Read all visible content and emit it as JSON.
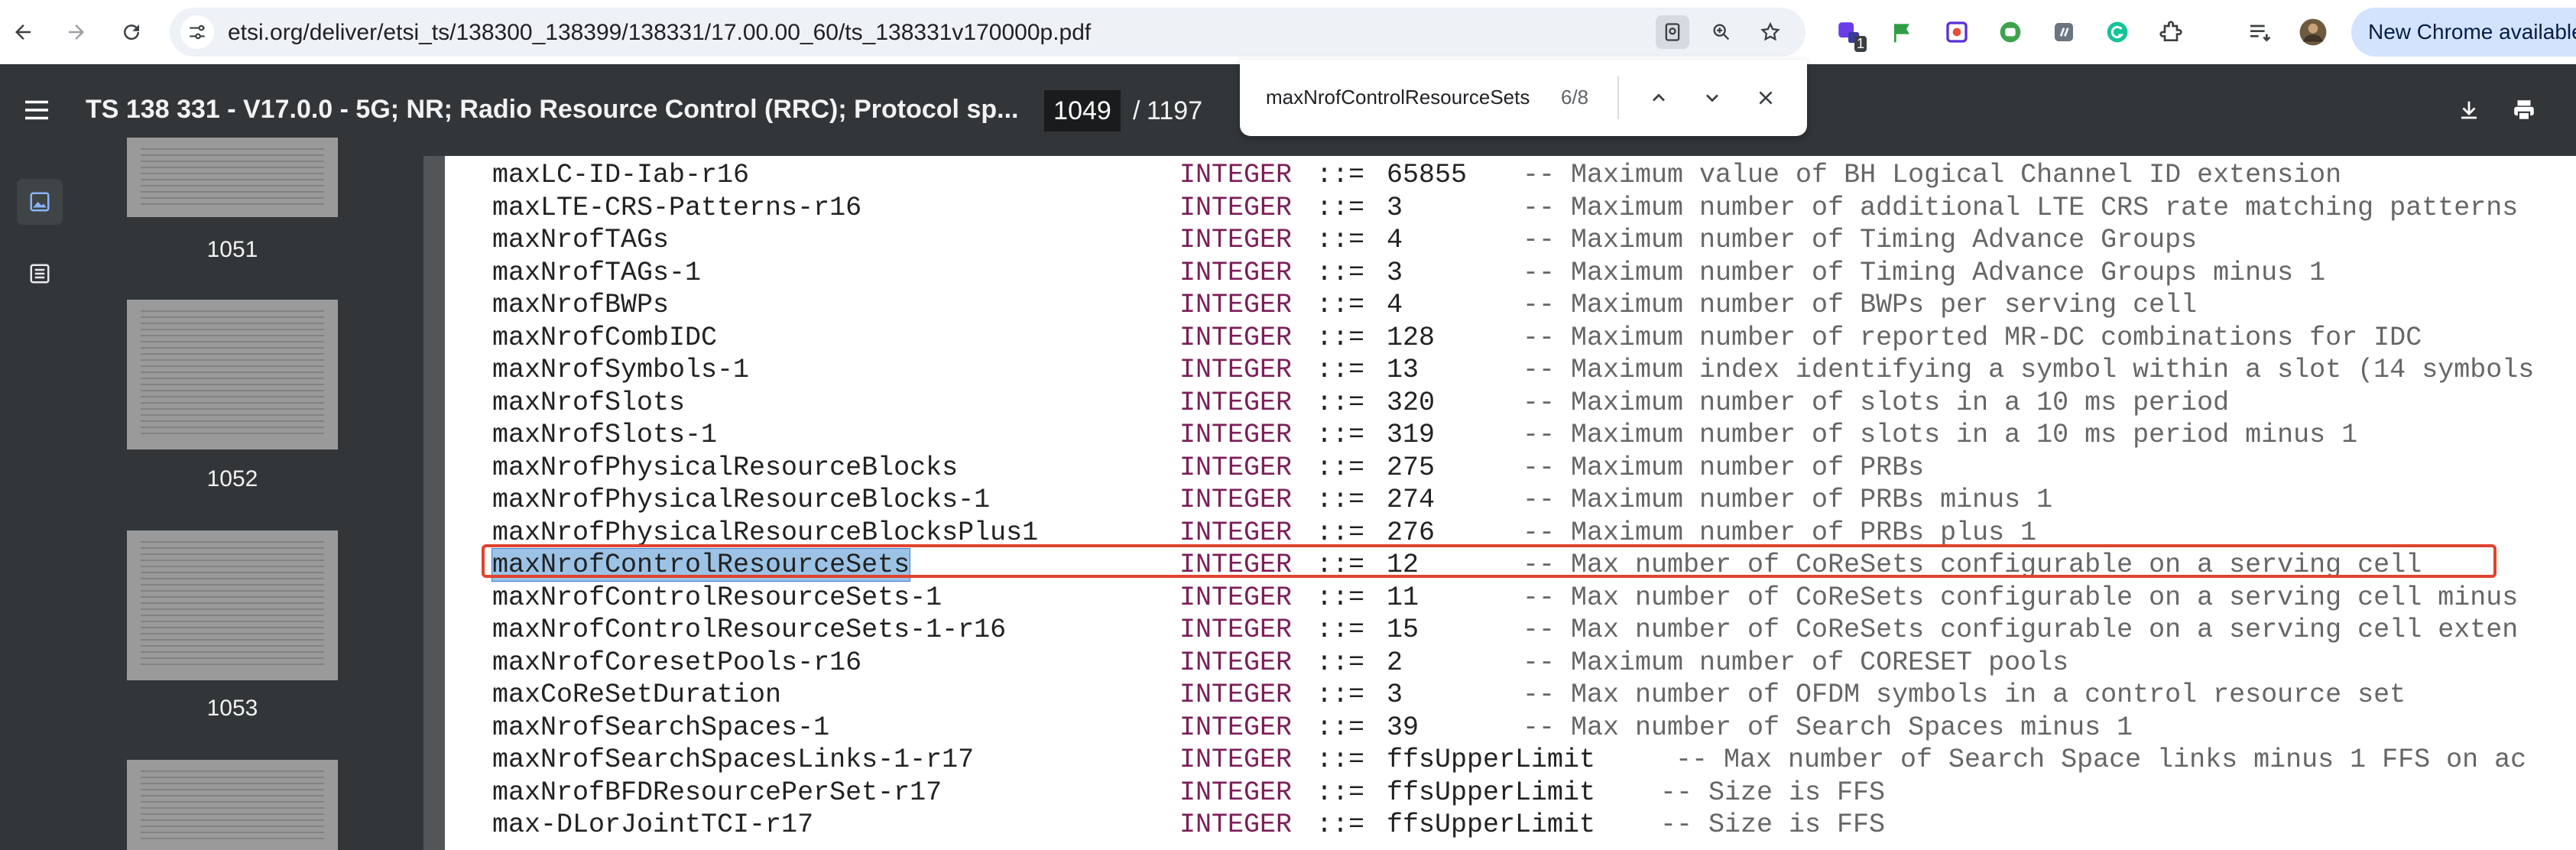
{
  "browser": {
    "url": "etsi.org/deliver/etsi_ts/138300_138399/138331/17.00.00_60/ts_138331v170000p.pdf",
    "update_label": "New Chrome available",
    "extension_badge": "1"
  },
  "toolbar": {
    "title": "TS 138 331 - V17.0.0 - 5G; NR; Radio Resource Control (RRC); Protocol sp...",
    "page_current": "1049",
    "page_separator": "/",
    "page_total": "1197"
  },
  "findbar": {
    "query": "maxNrofControlResourceSets",
    "count": "6/8"
  },
  "sidebar": {
    "thumbnails": [
      {
        "label": "1051"
      },
      {
        "label": "1052"
      },
      {
        "label": "1053"
      }
    ]
  },
  "rows": [
    {
      "name": "maxLC-ID-Iab-r16",
      "type": "INTEGER",
      "assign": "::=",
      "value": "65855",
      "comment": "-- Maximum value of BH Logical Channel ID extension"
    },
    {
      "name": "maxLTE-CRS-Patterns-r16",
      "type": "INTEGER",
      "assign": "::=",
      "value": "3",
      "comment": "-- Maximum number of additional LTE CRS rate matching patterns"
    },
    {
      "name": "maxNrofTAGs",
      "type": "INTEGER",
      "assign": "::=",
      "value": "4",
      "comment": "-- Maximum number of Timing Advance Groups"
    },
    {
      "name": "maxNrofTAGs-1",
      "type": "INTEGER",
      "assign": "::=",
      "value": "3",
      "comment": "-- Maximum number of Timing Advance Groups minus 1"
    },
    {
      "name": "maxNrofBWPs",
      "type": "INTEGER",
      "assign": "::=",
      "value": "4",
      "comment": "-- Maximum number of BWPs per serving cell"
    },
    {
      "name": "maxNrofCombIDC",
      "type": "INTEGER",
      "assign": "::=",
      "value": "128",
      "comment": "-- Maximum number of reported MR-DC combinations for IDC"
    },
    {
      "name": "maxNrofSymbols-1",
      "type": "INTEGER",
      "assign": "::=",
      "value": "13",
      "comment": "-- Maximum index identifying a symbol within a slot (14 symbols"
    },
    {
      "name": "maxNrofSlots",
      "type": "INTEGER",
      "assign": "::=",
      "value": "320",
      "comment": "-- Maximum number of slots in a 10 ms period"
    },
    {
      "name": "maxNrofSlots-1",
      "type": "INTEGER",
      "assign": "::=",
      "value": "319",
      "comment": "-- Maximum number of slots in a 10 ms period minus 1"
    },
    {
      "name": "maxNrofPhysicalResourceBlocks",
      "type": "INTEGER",
      "assign": "::=",
      "value": "275",
      "comment": "-- Maximum number of PRBs"
    },
    {
      "name": "maxNrofPhysicalResourceBlocks-1",
      "type": "INTEGER",
      "assign": "::=",
      "value": "274",
      "comment": "-- Maximum number of PRBs minus 1"
    },
    {
      "name": "maxNrofPhysicalResourceBlocksPlus1",
      "type": "INTEGER",
      "assign": "::=",
      "value": "276",
      "comment": "-- Maximum number of PRBs plus 1"
    },
    {
      "name": "maxNrofControlResourceSets",
      "type": "INTEGER",
      "assign": "::=",
      "value": "12",
      "comment": "-- Max number of CoReSets configurable on a serving cell"
    },
    {
      "name": "maxNrofControlResourceSets-1",
      "type": "INTEGER",
      "assign": "::=",
      "value": "11",
      "comment": "-- Max number of CoReSets configurable on a serving cell minus"
    },
    {
      "name": "maxNrofControlResourceSets-1-r16",
      "type": "INTEGER",
      "assign": "::=",
      "value": "15",
      "comment": "-- Max number of CoReSets configurable on a serving cell exten"
    },
    {
      "name": "maxNrofCoresetPools-r16",
      "type": "INTEGER",
      "assign": "::=",
      "value": "2",
      "comment": "-- Maximum number of CORESET pools"
    },
    {
      "name": "maxCoReSetDuration",
      "type": "INTEGER",
      "assign": "::=",
      "value": "3",
      "comment": "-- Max number of OFDM symbols in a control resource set"
    },
    {
      "name": "maxNrofSearchSpaces-1",
      "type": "INTEGER",
      "assign": "::=",
      "value": "39",
      "comment": "-- Max number of Search Spaces minus 1"
    },
    {
      "name": "maxNrofSearchSpacesLinks-1-r17",
      "type": "INTEGER",
      "assign": "::=",
      "value": "ffsUpperLimit",
      "comment": "-- Max number of Search Space links minus 1 FFS on ac"
    },
    {
      "name": "maxNrofBFDResourcePerSet-r17",
      "type": "INTEGER",
      "assign": "::=",
      "value": "ffsUpperLimit",
      "comment": "-- Size is FFS"
    },
    {
      "name": "max-DLorJointTCI-r17",
      "type": "INTEGER",
      "assign": "::=",
      "value": "ffsUpperLimit",
      "comment": "-- Size is FFS"
    }
  ],
  "colors": {
    "toolbar_bg": "#323639",
    "type_keyword": "#7b1f5a",
    "highlight": "#9cc3e6",
    "red_box": "#e0432f"
  },
  "icons": {
    "back": "arrow-back-icon",
    "forward": "arrow-forward-icon",
    "reload": "reload-icon",
    "menu": "hamburger-icon",
    "download": "download-icon",
    "print": "print-icon"
  }
}
